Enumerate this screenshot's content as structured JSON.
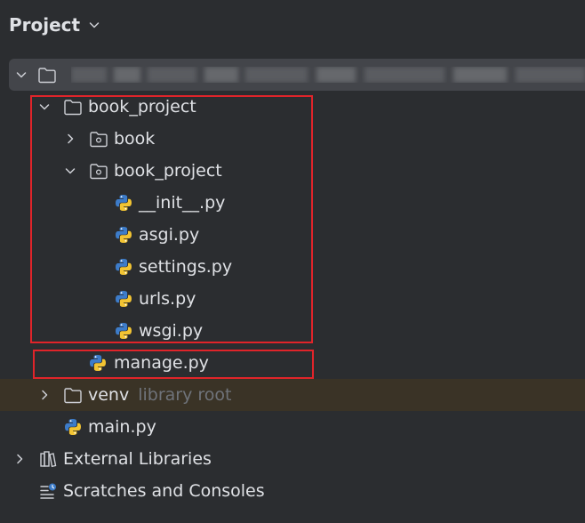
{
  "header": {
    "title": "Project"
  },
  "tree": {
    "root": {
      "label": ""
    },
    "book_project_dir": {
      "label": "book_project"
    },
    "book_dir": {
      "label": "book"
    },
    "book_project_pkg": {
      "label": "book_project"
    },
    "files": [
      {
        "label": "__init__.py"
      },
      {
        "label": "asgi.py"
      },
      {
        "label": "settings.py"
      },
      {
        "label": "urls.py"
      },
      {
        "label": "wsgi.py"
      }
    ],
    "manage": {
      "label": "manage.py"
    },
    "venv": {
      "label": "venv",
      "hint": "library root"
    },
    "main": {
      "label": "main.py"
    },
    "external": {
      "label": "External Libraries"
    },
    "scratches": {
      "label": "Scratches and Consoles"
    }
  },
  "colors": {
    "background": "#2b2d30",
    "selection": "#43454a",
    "venv_highlight": "#3a3326",
    "annotation_red": "#e0242a",
    "python_blue": "#3d7cc9",
    "python_yellow": "#f2c433"
  }
}
